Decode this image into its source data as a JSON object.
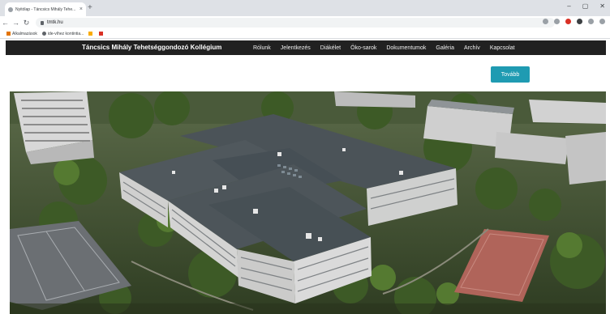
{
  "browser": {
    "tab_title": "Nyitólap - Táncsics Mihály Tehe...",
    "new_tab": "+",
    "window_controls": {
      "minimize": "–",
      "maximize": "▢",
      "close": "✕"
    },
    "url": "tmtk.hu",
    "bookmarks": [
      {
        "label": "Alkalmazások",
        "icon": "apps-icon"
      },
      {
        "label": "ide-víhez kontintia...",
        "icon": "bookmark-icon"
      }
    ]
  },
  "site": {
    "brand": "Táncsics Mihály Tehetséggondozó Kollégium",
    "menu": [
      "Rólunk",
      "Jelentkezés",
      "Diákélet",
      "Öko-sarok",
      "Dokumentumok",
      "Galéria",
      "Archív",
      "Kapcsolat"
    ],
    "more_button": "Tovább",
    "accent_color": "#1f9bb2",
    "nav_bg": "#212121"
  },
  "hero": {
    "image": "aerial-photo-of-college-campus"
  }
}
